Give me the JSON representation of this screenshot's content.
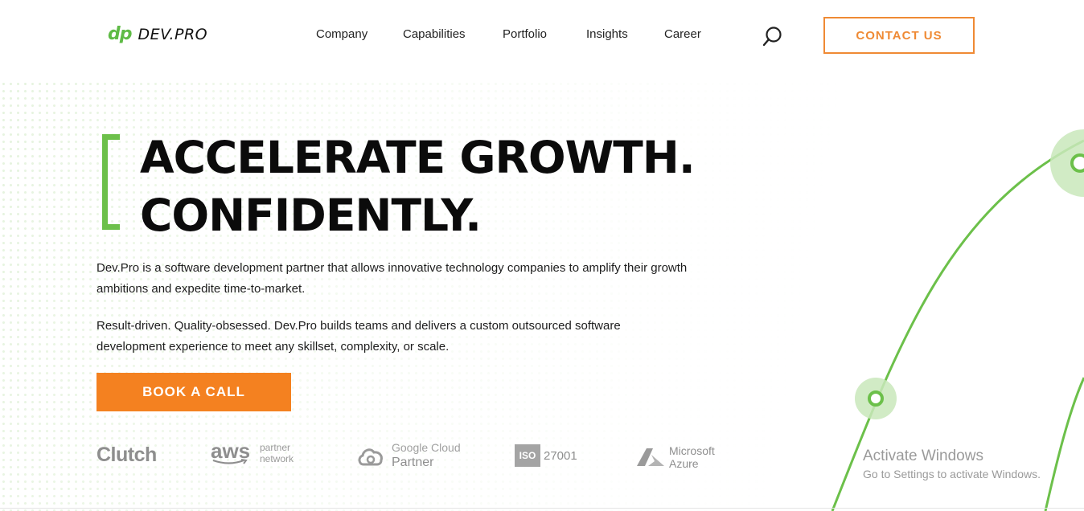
{
  "header": {
    "logo_mark": "dp",
    "logo_text": "DEV.PRO",
    "nav": [
      "Company",
      "Capabilities",
      "Portfolio",
      "Insights",
      "Career"
    ],
    "search_icon": "search-icon",
    "contact_label": "CONTACT US"
  },
  "hero": {
    "headline_line1": "ACCELERATE GROWTH.",
    "headline_line2": "CONFIDENTLY.",
    "paragraph1": "Dev.Pro is a software development partner that allows innovative technology companies to amplify their growth ambitions and expedite time-to-market.",
    "paragraph2": "Result-driven. Quality-obsessed. Dev.Pro builds teams and delivers a custom outsourced software development experience to meet any skillset, complexity, or scale.",
    "cta_label": "BOOK A CALL"
  },
  "partners": {
    "clutch": "Clutch",
    "aws": "aws",
    "aws_sub1": "partner",
    "aws_sub2": "network",
    "google_line1": "Google Cloud",
    "google_line2": "Partner",
    "iso_badge": "ISO",
    "iso_number": "27001",
    "azure_line1": "Microsoft",
    "azure_line2": "Azure"
  },
  "watermark": {
    "title": "Activate Windows",
    "subtitle": "Go to Settings to activate Windows."
  },
  "colors": {
    "accent_green": "#6cc04a",
    "accent_orange": "#f48120",
    "contact_border": "#ef8a34",
    "text_dark": "#0b0b0b"
  }
}
